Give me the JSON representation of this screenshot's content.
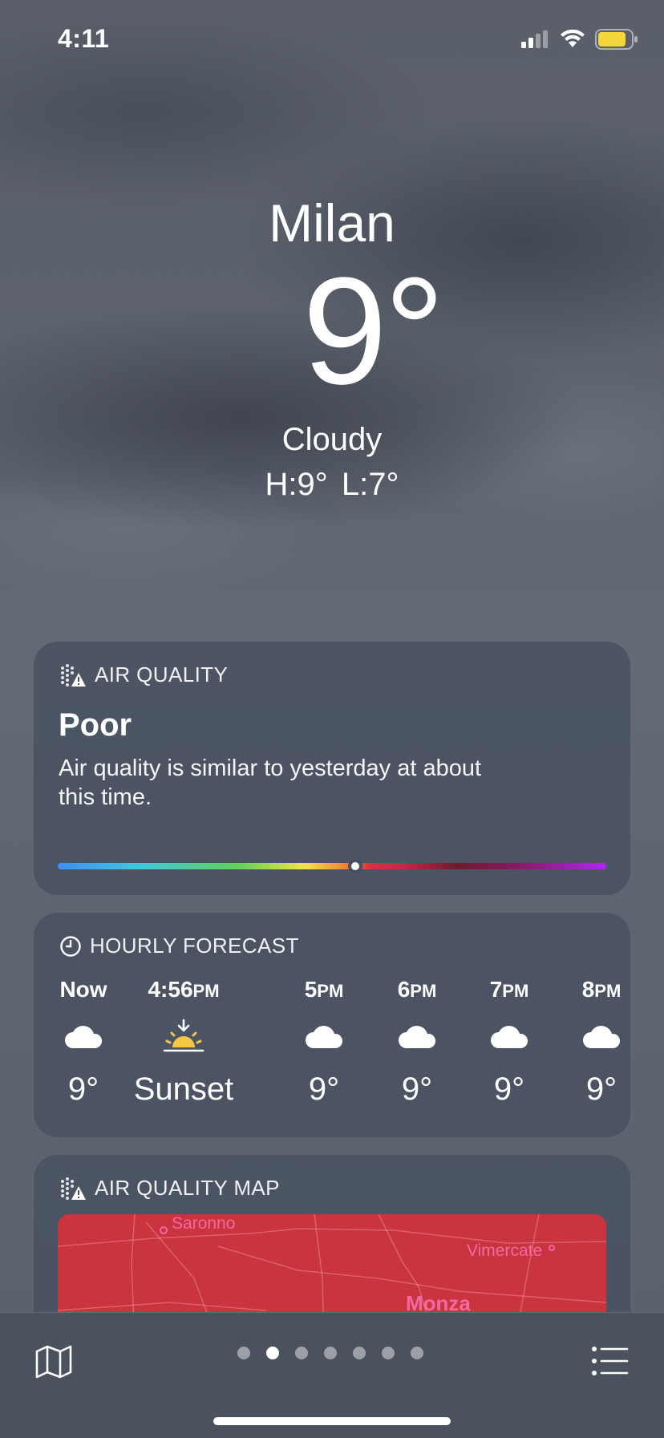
{
  "status": {
    "time": "4:11"
  },
  "hero": {
    "city": "Milan",
    "temp": "9°",
    "condition": "Cloudy",
    "high_low": "H:9°  L:7°"
  },
  "air_quality": {
    "header": "AIR QUALITY",
    "level": "Poor",
    "description": "Air quality is similar to yesterday at about this time.",
    "scale_position": 0.58
  },
  "hourly": {
    "header": "HOURLY FORECAST",
    "items": [
      {
        "time": "Now",
        "suffix": "",
        "icon": "cloud-icon",
        "value": "9°"
      },
      {
        "time": "4:56",
        "suffix": "PM",
        "icon": "sunset-icon",
        "value": "Sunset"
      },
      {
        "time": "5",
        "suffix": "PM",
        "icon": "cloud-icon",
        "value": "9°"
      },
      {
        "time": "6",
        "suffix": "PM",
        "icon": "cloud-icon",
        "value": "9°"
      },
      {
        "time": "7",
        "suffix": "PM",
        "icon": "cloud-icon",
        "value": "9°"
      },
      {
        "time": "8",
        "suffix": "PM",
        "icon": "cloud-icon",
        "value": "9°"
      }
    ]
  },
  "aq_map": {
    "header": "AIR QUALITY MAP",
    "labels": [
      "Saronno",
      "Vimercate",
      "Monza"
    ]
  },
  "pager": {
    "count": 7,
    "active": 1
  },
  "colors": {
    "card": "#485060",
    "map": "#c9343f",
    "sun": "#f5c842"
  }
}
